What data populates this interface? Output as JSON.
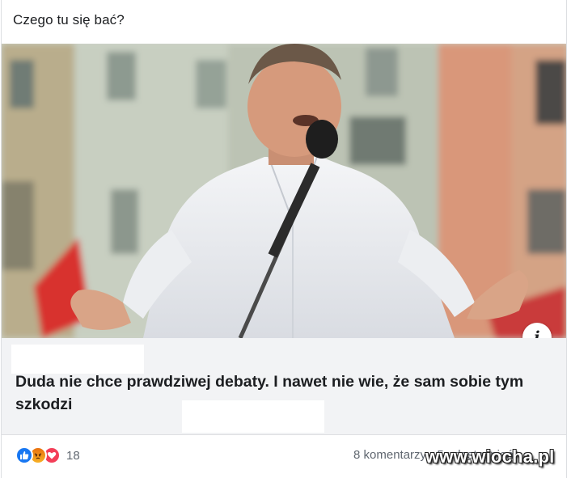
{
  "post": {
    "text": "Czego tu się bać?"
  },
  "link_preview": {
    "headline": "Duda nie chce prawdziwej debaty. I nawet nie wie, że sam sobie tym szkodzi",
    "info_icon": "i"
  },
  "footer": {
    "reaction_icons": [
      "like-icon",
      "angry-icon",
      "love-icon"
    ],
    "reaction_count": "18",
    "comments_text": "8 komentarzy · 5 udostępnień",
    "watermark": "www.wiocha.pl"
  },
  "colors": {
    "like": "#1877f2",
    "love": "#f33e58",
    "angry": "#f0a020",
    "card_bg": "#f2f3f5",
    "meta_text": "#606770"
  }
}
